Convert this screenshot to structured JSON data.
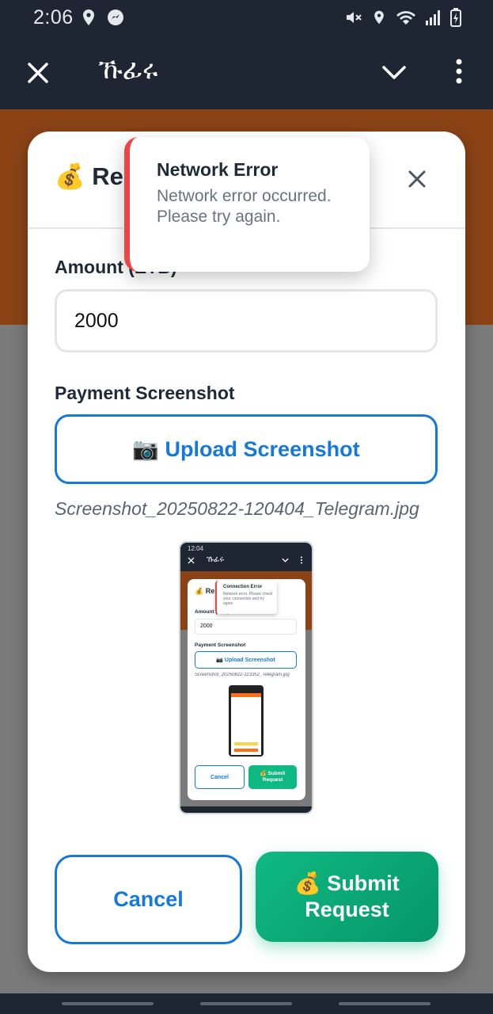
{
  "status_bar": {
    "time": "2:06",
    "icons": [
      "location-icon",
      "messenger-icon",
      "mute-icon",
      "location-icon",
      "wifi-icon",
      "signal-icon",
      "battery-icon"
    ]
  },
  "app_bar": {
    "title": "ኹፊሩ",
    "icons": [
      "close-icon",
      "chevron-down-icon",
      "more-vert-icon"
    ]
  },
  "modal": {
    "title": "💰 Request",
    "amount_label": "Amount (ETB)",
    "amount_value": "2000",
    "screenshot_label": "Payment Screenshot",
    "upload_button": "📷 Upload Screenshot",
    "file_name": "Screenshot_20250822-120404_Telegram.jpg",
    "cancel_button": "Cancel",
    "submit_button": "💰 Submit Request"
  },
  "toast": {
    "title": "Network Error",
    "message": "Network error occurred. Please try again."
  },
  "preview": {
    "time": "12:04",
    "app_title": "ኹፊሩ",
    "toast_title": "Connection Error",
    "toast_message": "Network error. Please check your connection and try again.",
    "amount_label": "Amount (ETB)",
    "amount_value": "2000",
    "screenshot_label": "Payment Screenshot",
    "upload_button": "📷 Upload Screenshot",
    "file_name": "Screenshot_20250822-113352_Telegram.jpg",
    "cancel_button": "Cancel",
    "submit_button": "💰 Submit Request"
  },
  "colors": {
    "accent_blue": "#1479d9",
    "submit_green": "#10b981",
    "error_red": "#ef4444",
    "header_bg": "#1e2633",
    "brown_band": "#8b4316"
  }
}
